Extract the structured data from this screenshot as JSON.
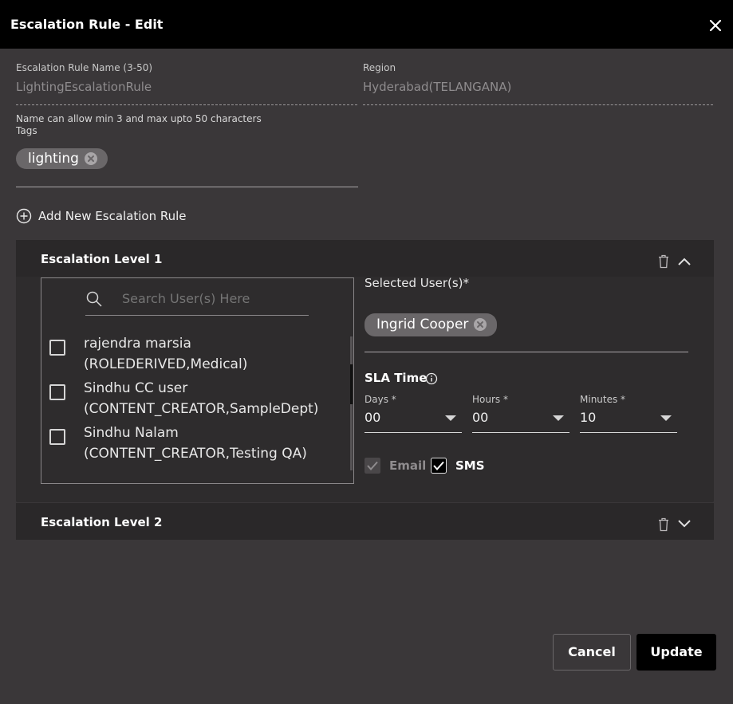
{
  "dialog": {
    "title": "Escalation Rule - Edit"
  },
  "form": {
    "name_label": "Escalation Rule Name (3-50)",
    "name_value": "LightingEscalationRule",
    "region_label": "Region",
    "region_value": "Hyderabad(TELANGANA)",
    "name_helper": "Name can allow min 3 and max upto 50 characters",
    "tags_label": "Tags",
    "tags": [
      "lighting"
    ],
    "add_rule_label": "Add New Escalation Rule"
  },
  "levels": [
    {
      "title": "Escalation Level 1",
      "expanded": true,
      "search_placeholder": "Search User(s) Here",
      "users": [
        {
          "name": "rajendra marsia",
          "role": "(ROLEDERIVED,Medical)",
          "checked": false
        },
        {
          "name": "Sindhu CC user",
          "role": "(CONTENT_CREATOR,SampleDept)",
          "checked": false
        },
        {
          "name": "Sindhu Nalam",
          "role": "(CONTENT_CREATOR,Testing QA)",
          "checked": false
        }
      ],
      "selected_label": "Selected User(s)*",
      "selected_users": [
        "Ingrid Cooper"
      ],
      "sla_title": "SLA Time",
      "sla": {
        "days_label": "Days *",
        "days_value": "00",
        "hours_label": "Hours *",
        "hours_value": "00",
        "minutes_label": "Minutes *",
        "minutes_value": "10"
      },
      "email_label": "Email",
      "email_checked": true,
      "email_disabled": true,
      "sms_label": "SMS",
      "sms_checked": true
    },
    {
      "title": "Escalation Level 2",
      "expanded": false
    }
  ],
  "actions": {
    "cancel_label": "Cancel",
    "update_label": "Update"
  },
  "colors": {
    "background": "#3a3739",
    "header": "#000000",
    "panel": "#2e2c2d",
    "chip": "#6a6769"
  }
}
